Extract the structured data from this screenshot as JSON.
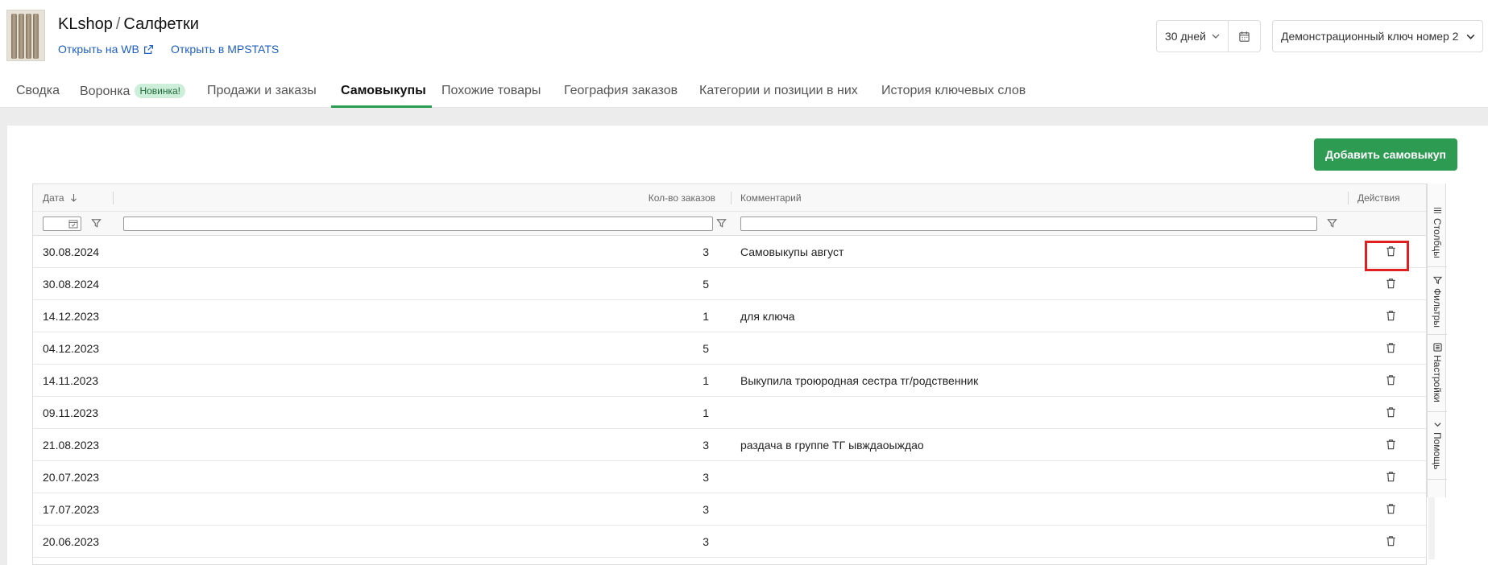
{
  "header": {
    "shop": "KLshop",
    "separator": "/",
    "product": "Салфетки",
    "link_wb": "Открыть на WB",
    "link_mpstats": "Открыть в MPSTATS",
    "period": "30 дней",
    "key_selector": "Демонстрационный ключ номер 2"
  },
  "tabs": [
    {
      "label": "Сводка"
    },
    {
      "label": "Воронка",
      "badge": "Новинка!"
    },
    {
      "label": "Продажи и заказы"
    },
    {
      "label": "Самовыкупы",
      "active": true
    },
    {
      "label": "Похожие товары"
    },
    {
      "label": "География заказов"
    },
    {
      "label": "Категории и позиции в них"
    },
    {
      "label": "История ключевых слов"
    }
  ],
  "actions": {
    "add_button": "Добавить самовыкуп"
  },
  "grid": {
    "columns": {
      "date": "Дата",
      "qty": "Кол-во заказов",
      "comment": "Комментарий",
      "actions": "Действия"
    },
    "rows": [
      {
        "date": "30.08.2024",
        "qty": "3",
        "comment": "Самовыкупы август"
      },
      {
        "date": "30.08.2024",
        "qty": "5",
        "comment": ""
      },
      {
        "date": "14.12.2023",
        "qty": "1",
        "comment": "для ключа"
      },
      {
        "date": "04.12.2023",
        "qty": "5",
        "comment": ""
      },
      {
        "date": "14.11.2023",
        "qty": "1",
        "comment": "Выкупила троюродная сестра тг/родственник"
      },
      {
        "date": "09.11.2023",
        "qty": "1",
        "comment": ""
      },
      {
        "date": "21.08.2023",
        "qty": "3",
        "comment": "раздача в группе ТГ ывждаоыждао"
      },
      {
        "date": "20.07.2023",
        "qty": "3",
        "comment": ""
      },
      {
        "date": "17.07.2023",
        "qty": "3",
        "comment": ""
      },
      {
        "date": "20.06.2023",
        "qty": "3",
        "comment": ""
      }
    ]
  },
  "sidebar": {
    "columns": "Столбцы",
    "filters": "Фильтры",
    "settings": "Настройки",
    "help": "Помощь"
  },
  "colors": {
    "accent_green": "#2e9b52",
    "link_blue": "#1f5fbf",
    "highlight_red": "#e02020"
  }
}
